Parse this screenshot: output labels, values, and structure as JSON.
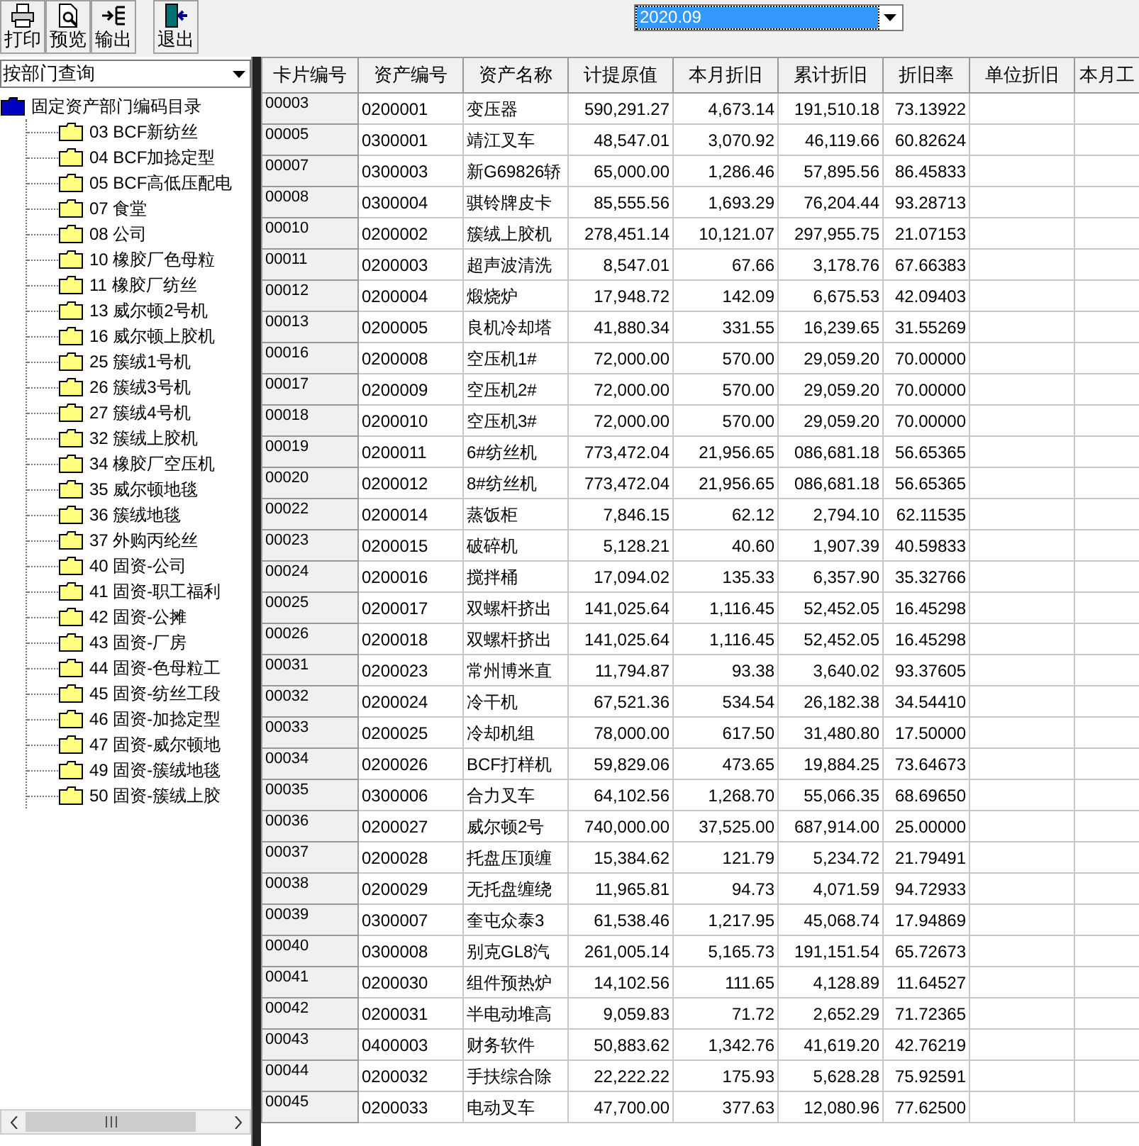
{
  "toolbar": {
    "buttons": [
      {
        "label": "打印",
        "kind": "print"
      },
      {
        "label": "预览",
        "kind": "preview"
      },
      {
        "label": "输出",
        "kind": "export"
      },
      {
        "label": "退出",
        "kind": "exit"
      }
    ],
    "period": {
      "value": "2020.09"
    }
  },
  "sidebar": {
    "query_mode": "按部门查询",
    "tree": {
      "label": "固定资产部门编码目录",
      "children": [
        {
          "label": "03 BCF新纺丝"
        },
        {
          "label": "04 BCF加捻定型"
        },
        {
          "label": "05 BCF高低压配电"
        },
        {
          "label": "07 食堂"
        },
        {
          "label": "08 公司"
        },
        {
          "label": "10 橡胶厂色母粒"
        },
        {
          "label": "11 橡胶厂纺丝"
        },
        {
          "label": "13 威尔顿2号机"
        },
        {
          "label": "16 威尔顿上胶机"
        },
        {
          "label": "25 簇绒1号机"
        },
        {
          "label": "26 簇绒3号机"
        },
        {
          "label": "27 簇绒4号机"
        },
        {
          "label": "32 簇绒上胶机"
        },
        {
          "label": "34 橡胶厂空压机"
        },
        {
          "label": "35 威尔顿地毯"
        },
        {
          "label": "36 簇绒地毯"
        },
        {
          "label": "37 外购丙纶丝"
        },
        {
          "label": "40 固资-公司"
        },
        {
          "label": "41 固资-职工福利"
        },
        {
          "label": "42 固资-公摊"
        },
        {
          "label": "43 固资-厂房"
        },
        {
          "label": "44 固资-色母粒工"
        },
        {
          "label": "45 固资-纺丝工段"
        },
        {
          "label": "46 固资-加捻定型"
        },
        {
          "label": "47 固资-威尔顿地"
        },
        {
          "label": "49 固资-簇绒地毯"
        },
        {
          "label": "50 固资-簇绒上胶"
        }
      ]
    }
  },
  "table": {
    "columns": [
      "卡片编号",
      "资产编号",
      "资产名称",
      "计提原值",
      "本月折旧",
      "累计折旧",
      "折旧率",
      "单位折旧",
      "本月工"
    ],
    "rows": [
      [
        "00003",
        "0200001",
        "变压器",
        "590,291.27",
        "4,673.14",
        "191,510.18",
        "73.13922"
      ],
      [
        "00005",
        "0300001",
        "靖江叉车",
        "48,547.01",
        "3,070.92",
        "46,119.66",
        "60.82624"
      ],
      [
        "00007",
        "0300003",
        "新G69826轿",
        "65,000.00",
        "1,286.46",
        "57,895.56",
        "86.45833"
      ],
      [
        "00008",
        "0300004",
        "骐铃牌皮卡",
        "85,555.56",
        "1,693.29",
        "76,204.44",
        "93.28713"
      ],
      [
        "00010",
        "0200002",
        "簇绒上胶机",
        "278,451.14",
        "10,121.07",
        "297,955.75",
        "21.07153"
      ],
      [
        "00011",
        "0200003",
        "超声波清洗",
        "8,547.01",
        "67.66",
        "3,178.76",
        "67.66383"
      ],
      [
        "00012",
        "0200004",
        "煅烧炉",
        "17,948.72",
        "142.09",
        "6,675.53",
        "42.09403"
      ],
      [
        "00013",
        "0200005",
        "良机冷却塔",
        "41,880.34",
        "331.55",
        "16,239.65",
        "31.55269"
      ],
      [
        "00016",
        "0200008",
        "空压机1#",
        "72,000.00",
        "570.00",
        "29,059.20",
        "70.00000"
      ],
      [
        "00017",
        "0200009",
        "空压机2#",
        "72,000.00",
        "570.00",
        "29,059.20",
        "70.00000"
      ],
      [
        "00018",
        "0200010",
        "空压机3#",
        "72,000.00",
        "570.00",
        "29,059.20",
        "70.00000"
      ],
      [
        "00019",
        "0200011",
        "6#纺丝机",
        "773,472.04",
        "21,956.65",
        "086,681.18",
        "56.65365"
      ],
      [
        "00020",
        "0200012",
        "8#纺丝机",
        "773,472.04",
        "21,956.65",
        "086,681.18",
        "56.65365"
      ],
      [
        "00022",
        "0200014",
        "蒸饭柜",
        "7,846.15",
        "62.12",
        "2,794.10",
        "62.11535"
      ],
      [
        "00023",
        "0200015",
        "破碎机",
        "5,128.21",
        "40.60",
        "1,907.39",
        "40.59833"
      ],
      [
        "00024",
        "0200016",
        "搅拌桶",
        "17,094.02",
        "135.33",
        "6,357.90",
        "35.32766"
      ],
      [
        "00025",
        "0200017",
        "双螺杆挤出",
        "141,025.64",
        "1,116.45",
        "52,452.05",
        "16.45298"
      ],
      [
        "00026",
        "0200018",
        "双螺杆挤出",
        "141,025.64",
        "1,116.45",
        "52,452.05",
        "16.45298"
      ],
      [
        "00031",
        "0200023",
        "常州博米直",
        "11,794.87",
        "93.38",
        "3,640.02",
        "93.37605"
      ],
      [
        "00032",
        "0200024",
        "冷干机",
        "67,521.36",
        "534.54",
        "26,182.38",
        "34.54410"
      ],
      [
        "00033",
        "0200025",
        "冷却机组",
        "78,000.00",
        "617.50",
        "31,480.80",
        "17.50000"
      ],
      [
        "00034",
        "0200026",
        "BCF打样机",
        "59,829.06",
        "473.65",
        "19,884.25",
        "73.64673"
      ],
      [
        "00035",
        "0300006",
        "合力叉车",
        "64,102.56",
        "1,268.70",
        "55,066.35",
        "68.69650"
      ],
      [
        "00036",
        "0200027",
        "威尔顿2号",
        "740,000.00",
        "37,525.00",
        "687,914.00",
        "25.00000"
      ],
      [
        "00037",
        "0200028",
        "托盘压顶缠",
        "15,384.62",
        "121.79",
        "5,234.72",
        "21.79491"
      ],
      [
        "00038",
        "0200029",
        "无托盘缠绕",
        "11,965.81",
        "94.73",
        "4,071.59",
        "94.72933"
      ],
      [
        "00039",
        "0300007",
        "奎屯众泰3",
        "61,538.46",
        "1,217.95",
        "45,068.74",
        "17.94869"
      ],
      [
        "00040",
        "0300008",
        "别克GL8汽",
        "261,005.14",
        "5,165.73",
        "191,151.54",
        "65.72673"
      ],
      [
        "00041",
        "0200030",
        "组件预热炉",
        "14,102.56",
        "111.65",
        "4,128.89",
        "11.64527"
      ],
      [
        "00042",
        "0200031",
        "半电动堆高",
        "9,059.83",
        "71.72",
        "2,652.29",
        "71.72365"
      ],
      [
        "00043",
        "0400003",
        "财务软件",
        "50,883.62",
        "1,342.76",
        "41,619.20",
        "42.76219"
      ],
      [
        "00044",
        "0200032",
        "手扶综合除",
        "22,222.22",
        "175.93",
        "5,628.28",
        "75.92591"
      ],
      [
        "00045",
        "0200033",
        "电动叉车",
        "47,700.00",
        "377.63",
        "12,080.96",
        "77.62500"
      ]
    ]
  }
}
